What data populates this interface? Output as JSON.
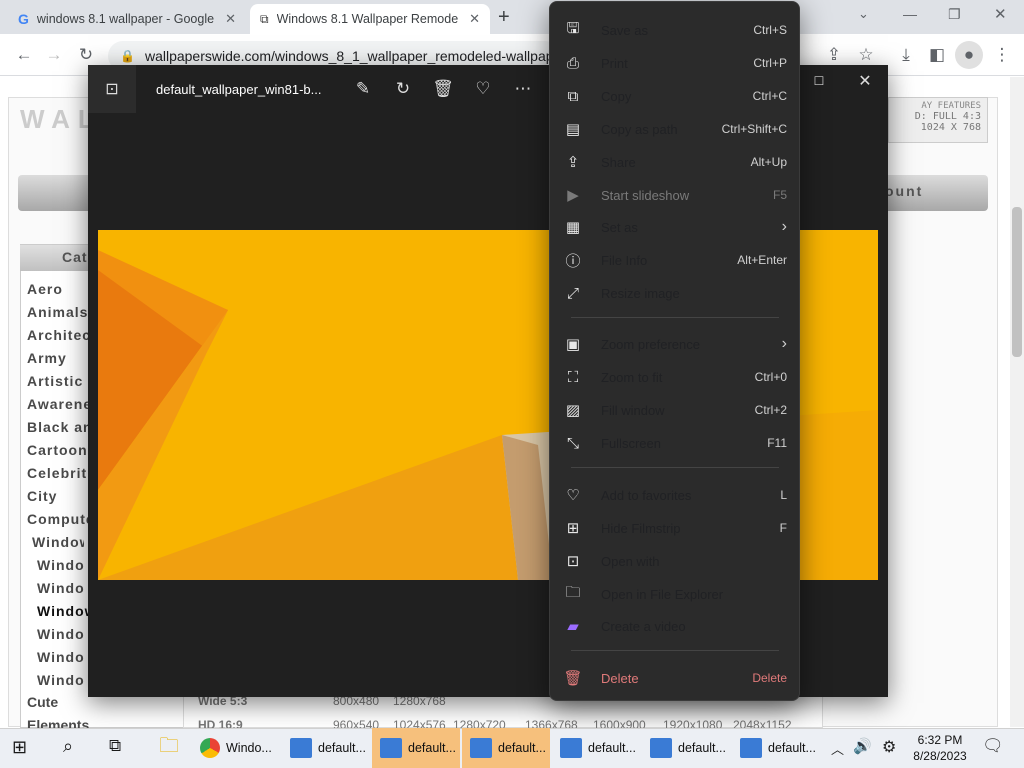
{
  "browser": {
    "tabs": [
      {
        "title": "windows 8.1 wallpaper - Google",
        "close": "✕"
      },
      {
        "title": "Windows 8.1 Wallpaper Remode",
        "close": "✕"
      }
    ],
    "new_tab": "+",
    "url": "wallpaperswide.com/windows_8_1_wallpaper_remodeled-wallpape"
  },
  "website": {
    "features_label": "AY FEATURES",
    "features_line1": "D:     FULL 4:3",
    "features_line2": "1024 X 768",
    "account_button": "ount",
    "categories_header": "Cate",
    "categories": [
      "Aero",
      "Animals",
      "Architect",
      "Army",
      "Artistic",
      "Awarene",
      "Black an",
      "Cartoon",
      "Celebrit",
      "City",
      "Compute"
    ],
    "subcategories": [
      "Window",
      "Windo",
      "Windo",
      "Window",
      "Windo",
      "Windo",
      "Windo"
    ],
    "bottom_row1": {
      "label": "Wide 5:3",
      "values": [
        "800x480",
        "1280x768"
      ]
    },
    "bottom_row2": {
      "label": "HD 16:9",
      "values": [
        "960x540",
        "1024x576",
        "1280x720",
        "1366x768",
        "1600x900",
        "1920x1080",
        "2048x1152"
      ]
    },
    "bottom_left": [
      "Cute",
      "Elements"
    ]
  },
  "photos": {
    "filename": "default_wallpaper_win81-b..."
  },
  "menu": {
    "items": [
      {
        "label": "Save as",
        "shortcut": "Ctrl+S",
        "icon": "save-icon",
        "glyph": "🖫"
      },
      {
        "label": "Print",
        "shortcut": "Ctrl+P",
        "icon": "print-icon",
        "glyph": "⎙"
      },
      {
        "label": "Copy",
        "shortcut": "Ctrl+C",
        "icon": "copy-icon",
        "glyph": "⧉"
      },
      {
        "label": "Copy as path",
        "shortcut": "Ctrl+Shift+C",
        "icon": "copy-path-icon",
        "glyph": "▤"
      },
      {
        "label": "Share",
        "shortcut": "Alt+Up",
        "icon": "share-icon",
        "glyph": "⇪"
      },
      {
        "label": "Start slideshow",
        "shortcut": "F5",
        "icon": "slideshow-icon",
        "glyph": "▶"
      },
      {
        "label": "Set as",
        "shortcut": "›",
        "icon": "set-as-icon",
        "glyph": "▦"
      },
      {
        "label": "File Info",
        "shortcut": "Alt+Enter",
        "icon": "info-icon",
        "glyph": "ⓘ"
      },
      {
        "label": "Resize image",
        "shortcut": "",
        "icon": "resize-icon",
        "glyph": "⤢"
      },
      {
        "label": "Zoom preference",
        "shortcut": "›",
        "icon": "zoom-preference-icon",
        "glyph": "▣"
      },
      {
        "label": "Zoom to fit",
        "shortcut": "Ctrl+0",
        "icon": "zoom-fit-icon",
        "glyph": "⛶"
      },
      {
        "label": "Fill window",
        "shortcut": "Ctrl+2",
        "icon": "fill-window-icon",
        "glyph": "▨"
      },
      {
        "label": "Fullscreen",
        "shortcut": "F11",
        "icon": "fullscreen-icon",
        "glyph": "⤡"
      },
      {
        "label": "Add to favorites",
        "shortcut": "L",
        "icon": "heart-icon",
        "glyph": "♡"
      },
      {
        "label": "Hide Filmstrip",
        "shortcut": "F",
        "icon": "filmstrip-icon",
        "glyph": "⊞"
      },
      {
        "label": "Open with",
        "shortcut": "",
        "icon": "open-with-icon",
        "glyph": "⊡"
      },
      {
        "label": "Open in File Explorer",
        "shortcut": "",
        "icon": "folder-icon",
        "glyph": "🗀"
      },
      {
        "label": "Create a video",
        "shortcut": "",
        "icon": "video-icon",
        "glyph": "▰"
      },
      {
        "label": "Delete",
        "shortcut": "Delete",
        "icon": "trash-icon",
        "glyph": "🗑"
      }
    ]
  },
  "taskbar": {
    "apps": [
      {
        "label": "Windo..."
      },
      {
        "label": "default..."
      },
      {
        "label": "default..."
      },
      {
        "label": "default..."
      },
      {
        "label": "default..."
      },
      {
        "label": "default..."
      },
      {
        "label": "default..."
      }
    ],
    "time": "6:32 PM",
    "date": "8/28/2023"
  },
  "colors": {
    "menu_bg": "#2b2b2b",
    "photos_bg": "#202020",
    "highlight_task": "#f6c07c",
    "delete_red": "#e07a7a"
  }
}
